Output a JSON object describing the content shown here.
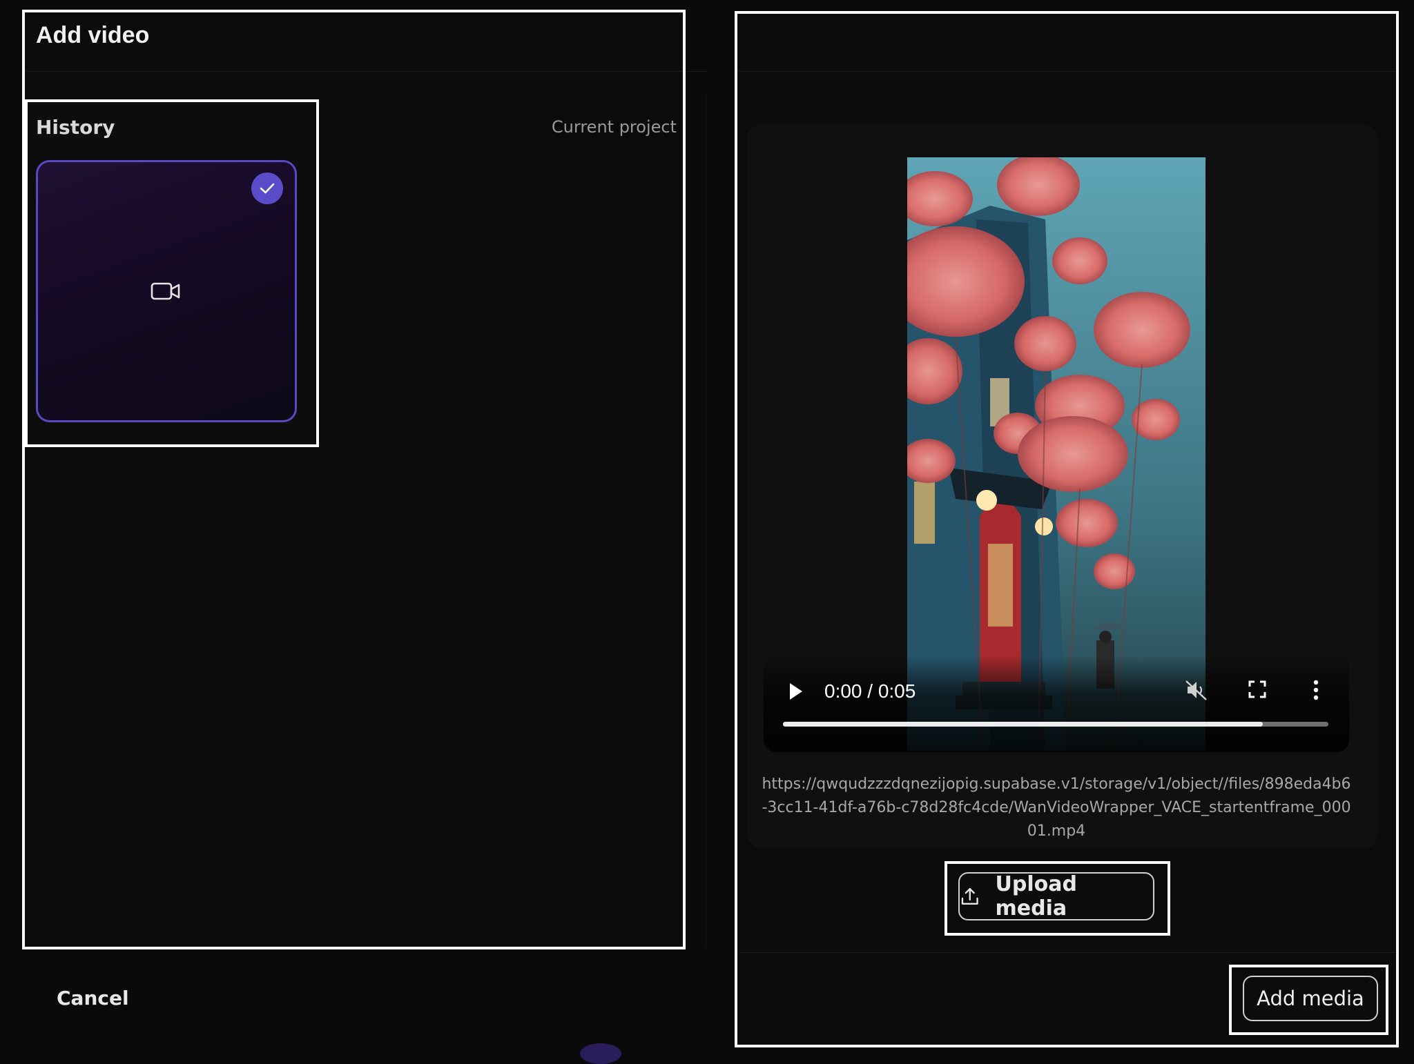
{
  "dialog": {
    "title": "Add video"
  },
  "history": {
    "label": "History",
    "filter_label": "Current project",
    "items": [
      {
        "type": "video",
        "selected": true,
        "icon": "video-camera-icon"
      }
    ]
  },
  "preview": {
    "time": "0:00 / 0:05",
    "progress": 0.88,
    "controls": [
      "play-icon",
      "mute-icon",
      "fullscreen-icon",
      "more-icon"
    ],
    "url": "https://qwqudzzzdqnezijopig.supabase.v1/storage/v1/object//files/898eda4b6-3cc11-41df-a76b-c78d28fc4cde/WanVideoWrapper_VACE_startentframe_00001.mp4"
  },
  "actions": {
    "upload_label": "Upload media",
    "cancel_label": "Cancel",
    "add_label": "Add media"
  },
  "colors": {
    "accent": "#5a4cc8",
    "background": "#0a0a0a",
    "thumb_border": "#5b48c4"
  }
}
